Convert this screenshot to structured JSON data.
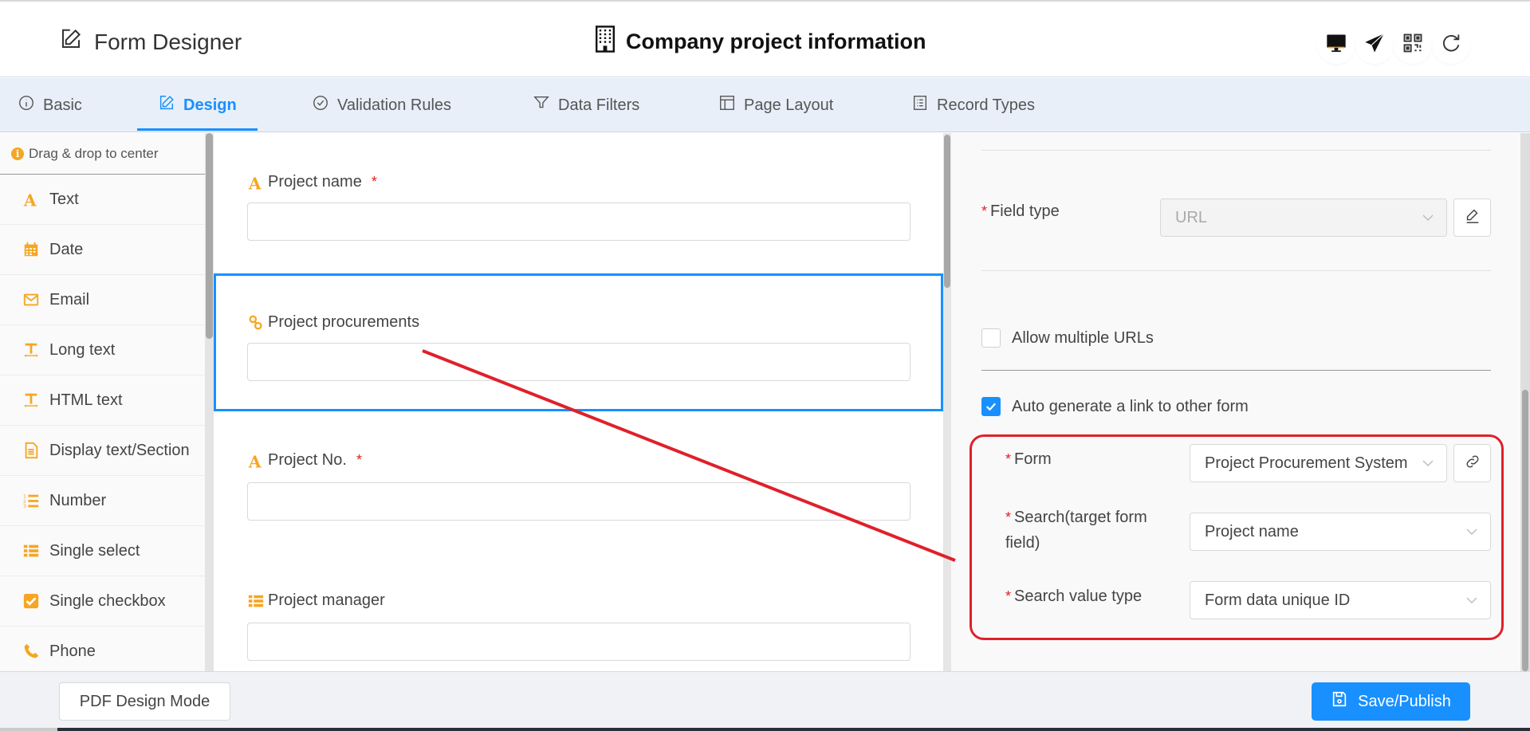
{
  "header": {
    "app_title": "Form Designer",
    "form_title": "Company project information",
    "tools": [
      {
        "name": "desktop-preview",
        "icon": "monitor-icon"
      },
      {
        "name": "publish-send",
        "icon": "paper-plane-icon"
      },
      {
        "name": "qr-code",
        "icon": "qr-code-icon"
      },
      {
        "name": "refresh",
        "icon": "refresh-icon"
      }
    ]
  },
  "tabs": [
    {
      "label": "Basic",
      "icon": "info-circle-icon",
      "active": false
    },
    {
      "label": "Design",
      "icon": "edit-icon",
      "active": true
    },
    {
      "label": "Validation Rules",
      "icon": "check-circle-icon",
      "active": false
    },
    {
      "label": "Data Filters",
      "icon": "filter-icon",
      "active": false
    },
    {
      "label": "Page Layout",
      "icon": "layout-icon",
      "active": false
    },
    {
      "label": "Record Types",
      "icon": "list-icon",
      "active": false
    }
  ],
  "sidebar": {
    "hint": "Drag & drop to center",
    "items": [
      {
        "label": "Text",
        "icon": "text-a-icon"
      },
      {
        "label": "Date",
        "icon": "calendar-icon"
      },
      {
        "label": "Email",
        "icon": "envelope-icon"
      },
      {
        "label": "Long text",
        "icon": "long-text-icon"
      },
      {
        "label": "HTML text",
        "icon": "html-text-icon"
      },
      {
        "label": "Display text/Section",
        "icon": "document-icon"
      },
      {
        "label": "Number",
        "icon": "numbered-list-icon"
      },
      {
        "label": "Single select",
        "icon": "list-icon"
      },
      {
        "label": "Single checkbox",
        "icon": "checkbox-icon"
      },
      {
        "label": "Phone",
        "icon": "phone-icon"
      }
    ]
  },
  "canvas": {
    "fields": [
      {
        "label": "Project name",
        "icon": "text-a-icon",
        "required": true,
        "required_mark": "*",
        "value": "",
        "selected": false
      },
      {
        "label": "Project procurements",
        "icon": "link-icon",
        "required": false,
        "required_mark": "",
        "value": "",
        "selected": true
      },
      {
        "label": "Project No.",
        "icon": "text-a-icon",
        "required": true,
        "required_mark": "*",
        "value": "",
        "selected": false
      },
      {
        "label": "Project manager",
        "icon": "list-icon",
        "required": false,
        "required_mark": "",
        "value": "",
        "selected": false
      }
    ]
  },
  "properties": {
    "required_mark": "*",
    "field_type": {
      "label": "Field type",
      "value": "URL",
      "disabled": true
    },
    "allow_multiple": {
      "label": "Allow multiple URLs",
      "checked": false
    },
    "auto_link": {
      "label": "Auto generate a link to other form",
      "checked": true
    },
    "form": {
      "label": "Form",
      "value": "Project Procurement System"
    },
    "search_field": {
      "label": "Search(target form field)",
      "value": "Project name"
    },
    "search_value_type": {
      "label": "Search value type",
      "value": "Form data unique ID"
    }
  },
  "annotation": {
    "color": "#e0202a",
    "description": "Red arrow from Project procurements field to highlighted link settings"
  },
  "footer": {
    "pdf_mode_label": "PDF Design Mode",
    "save_label": "Save/Publish"
  },
  "colors": {
    "accent": "#1890ff",
    "icon_orange": "#f5a623",
    "required": "#e02020"
  }
}
